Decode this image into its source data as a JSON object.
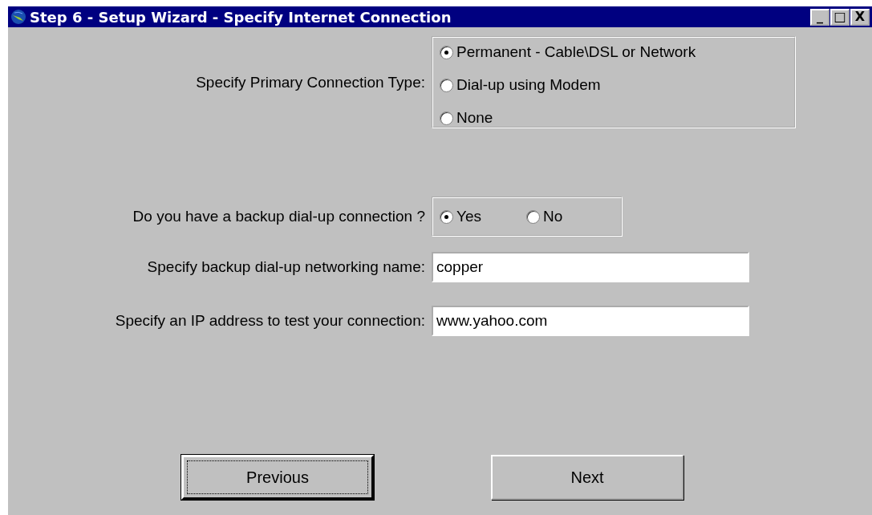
{
  "window": {
    "title": "Step 6 - Setup Wizard - Specify Internet Connection",
    "controls": [
      "_",
      "□",
      "X"
    ]
  },
  "connection_type": {
    "label": "Specify Primary Connection Type:",
    "options": [
      {
        "label": "Permanent - Cable\\DSL or Network",
        "selected": true
      },
      {
        "label": "Dial-up using Modem",
        "selected": false
      },
      {
        "label": "None",
        "selected": false
      }
    ]
  },
  "backup": {
    "label": "Do you have a backup dial-up connection ?",
    "options": [
      {
        "label": "Yes",
        "selected": true
      },
      {
        "label": "No",
        "selected": false
      }
    ]
  },
  "fields": [
    {
      "label": "Specify backup dial-up networking name:",
      "value": "copper"
    },
    {
      "label": "Specify an IP address to test your connection:",
      "value": "www.yahoo.com"
    }
  ],
  "buttons": [
    {
      "label": "Previous",
      "focused": true
    },
    {
      "label": "Next",
      "focused": false
    }
  ]
}
